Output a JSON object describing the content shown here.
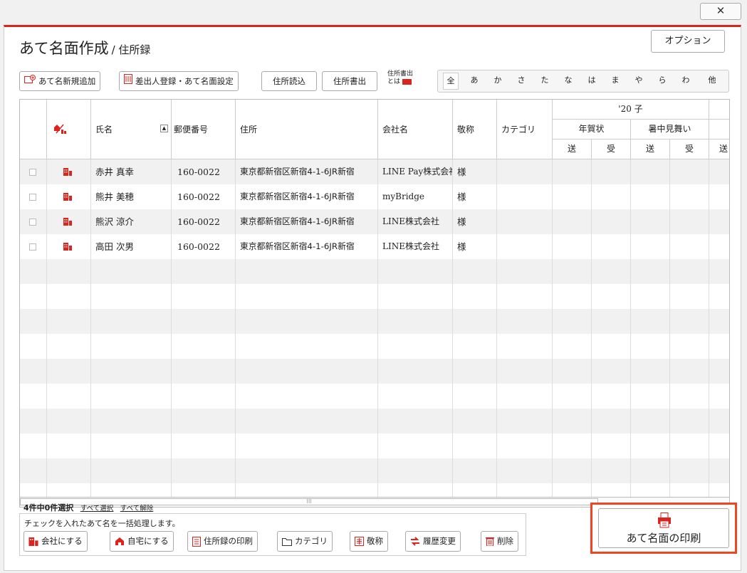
{
  "window": {
    "close_label": "✕"
  },
  "header": {
    "title": "あて名面作成",
    "subtitle": "/ 住所録",
    "options_label": "オプション"
  },
  "toolbar": {
    "add_label": "あて名新規追加",
    "sender_label": "差出人登録・あて名面設定",
    "import_label": "住所読込",
    "export_label": "住所書出",
    "export_info_line1": "住所書出",
    "export_info_line2": "とは"
  },
  "kana_filters": [
    "全",
    "あ",
    "か",
    "さ",
    "た",
    "な",
    "は",
    "ま",
    "や",
    "ら",
    "わ",
    "他"
  ],
  "table": {
    "headers": {
      "name": "氏名",
      "zip": "郵便番号",
      "address": "住所",
      "company": "会社名",
      "honorific": "敬称",
      "category": "カテゴリ",
      "year_group": "'20 子",
      "nenga": "年賀状",
      "shochu": "暑中見舞い",
      "send": "送",
      "recv": "受"
    },
    "rows": [
      {
        "name": "赤井 真幸",
        "zip": "160-0022",
        "address": "東京都新宿区新宿4-1-6JR新宿",
        "company": "LINE Pay株式会社",
        "honorific": "様"
      },
      {
        "name": "熊井 美穂",
        "zip": "160-0022",
        "address": "東京都新宿区新宿4-1-6JR新宿",
        "company": "myBridge",
        "honorific": "様"
      },
      {
        "name": "熊沢 涼介",
        "zip": "160-0022",
        "address": "東京都新宿区新宿4-1-6JR新宿",
        "company": "LINE株式会社",
        "honorific": "様"
      },
      {
        "name": "高田 次男",
        "zip": "160-0022",
        "address": "東京都新宿区新宿4-1-6JR新宿",
        "company": "LINE株式会社",
        "honorific": "様"
      }
    ]
  },
  "selection": {
    "summary": "4件中0件選択",
    "select_all": "すべて選択",
    "deselect_all": "すべて解除"
  },
  "bulk": {
    "description": "チェックを入れたあて名を一括処理します。",
    "company_label": "会社にする",
    "home_label": "自宅にする",
    "print_list_label": "住所録の印刷",
    "category_label": "カテゴリ",
    "honorific_label": "敬称",
    "history_label": "履歴変更",
    "delete_label": "削除"
  },
  "print": {
    "label": "あて名面の印刷"
  },
  "colors": {
    "accent": "#d9251d",
    "highlight": "#ef4523"
  }
}
